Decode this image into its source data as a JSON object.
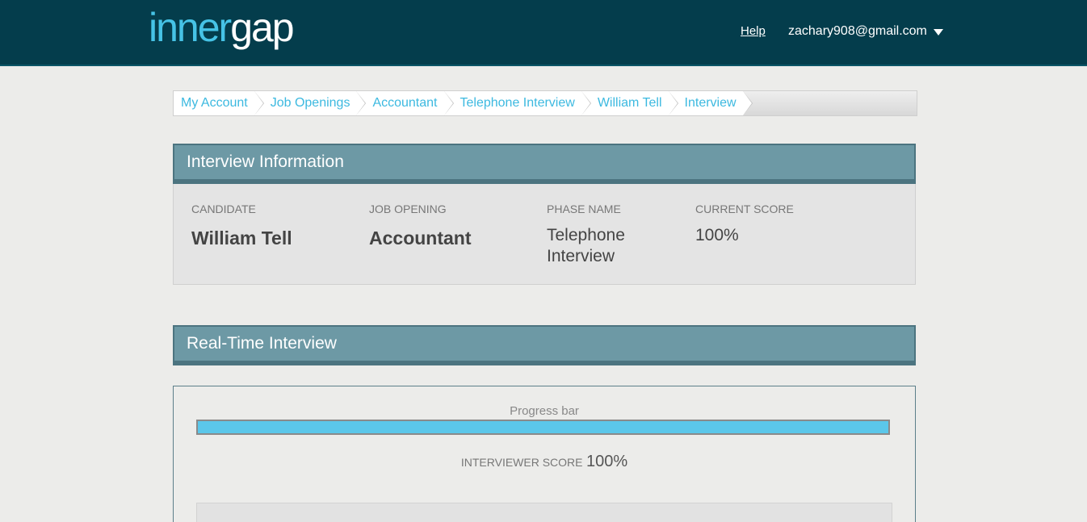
{
  "header": {
    "logo_part1": "inner",
    "logo_part2": "gap",
    "help_label": "Help",
    "user_email": "zachary908@gmail.com"
  },
  "breadcrumb": [
    "My Account",
    "Job Openings",
    "Accountant",
    "Telephone Interview",
    "William Tell",
    "Interview"
  ],
  "interview_info": {
    "title": "Interview Information",
    "candidate_label": "CANDIDATE",
    "candidate_value": "William Tell",
    "job_label": "JOB OPENING",
    "job_value": "Accountant",
    "phase_label": "PHASE NAME",
    "phase_value_line1": "Telephone",
    "phase_value_line2": "Interview",
    "score_label": "CURRENT SCORE",
    "score_value": "100%"
  },
  "realtime": {
    "title": "Real-Time Interview",
    "progress_label": "Progress bar",
    "progress_fraction": 1.0,
    "interviewer_score_label": "INTERVIEWER SCORE",
    "interviewer_score_value": "100%"
  },
  "colors": {
    "header_bg": "#043d4c",
    "accent": "#46c3e6",
    "section_head_bg": "#6d99a5",
    "progress_fill": "#5bc7ea"
  }
}
